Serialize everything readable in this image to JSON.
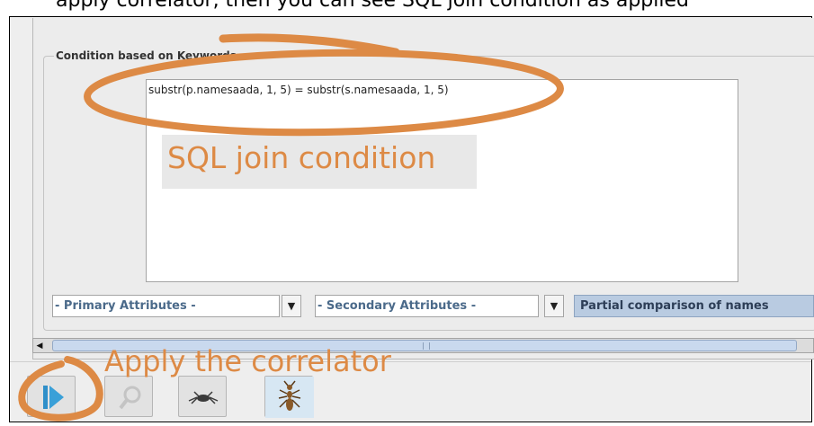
{
  "caption": {
    "top_text": "apply correlator, then you can see SQL join condition as applied"
  },
  "panel": {
    "group_title": "Condition based on Keywords",
    "sql_condition": "substr(p.namesaada, 1, 5) = substr(s.namesaada, 1, 5)"
  },
  "controls": {
    "primary_attributes": "- Primary Attributes -",
    "secondary_attributes": "- Secondary Attributes -",
    "partial_comparison_label": "Partial comparison of names"
  },
  "annotations": {
    "sql_label": "SQL join condition",
    "apply_label": "Apply the correlator",
    "color": "#dd8a45"
  },
  "toolbar": {
    "buttons": [
      {
        "icon": "play-icon",
        "enabled": true
      },
      {
        "icon": "search-icon",
        "enabled": false
      },
      {
        "icon": "spider-icon",
        "enabled": true
      },
      {
        "icon": "ant-icon",
        "enabled": true
      }
    ]
  }
}
